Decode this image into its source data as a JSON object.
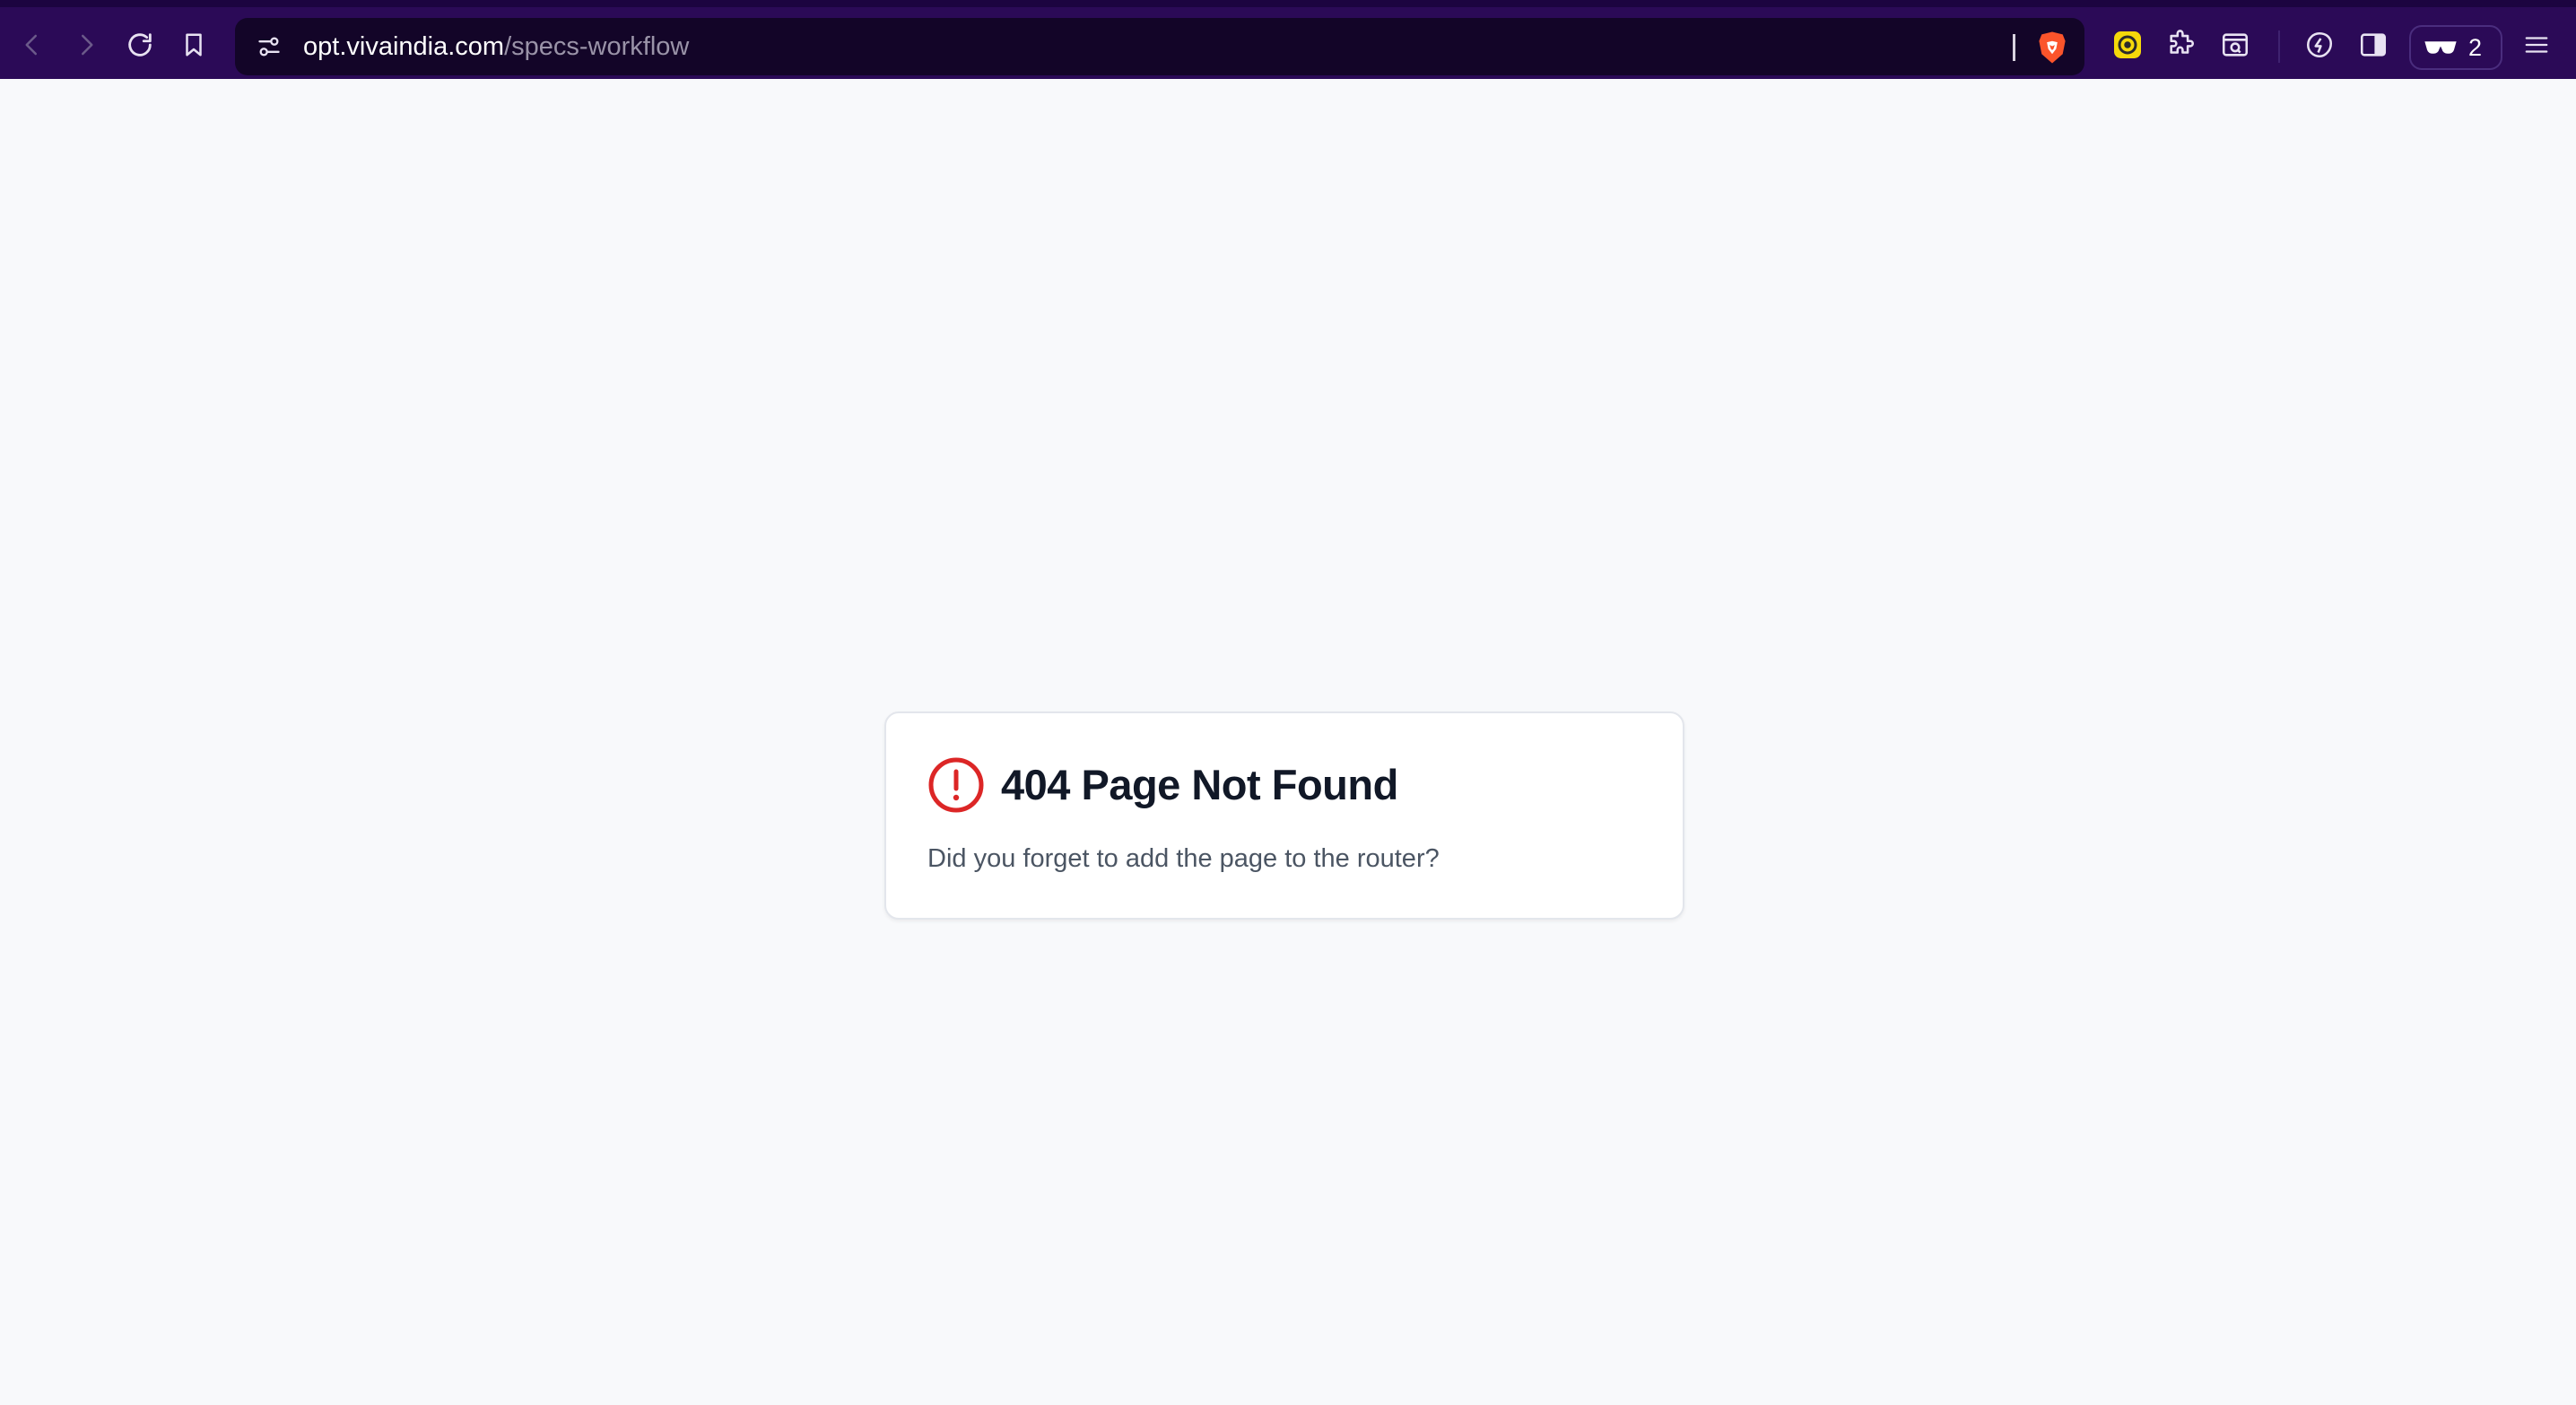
{
  "browser": {
    "url_host": "opt.vivaindia.com",
    "url_path": "/specs-workflow",
    "wallet_count": "2",
    "icons": {
      "back": "back-arrow-icon",
      "forward": "forward-arrow-icon",
      "reload": "reload-icon",
      "bookmark": "bookmark-icon",
      "site_settings": "tune-icon",
      "shields": "brave-shield-icon",
      "extension_1": "yellow-extension-icon",
      "extensions": "puzzle-icon",
      "tab_search": "tab-search-icon",
      "leo": "leo-ai-icon",
      "sidebar": "sidebar-icon",
      "wallet": "glasses-icon",
      "menu": "hamburger-menu-icon"
    }
  },
  "page": {
    "title": "404 Page Not Found",
    "message": "Did you forget to add the page to the router?",
    "icon": "alert-circle-icon",
    "icon_color": "#dc2626"
  },
  "colors": {
    "toolbar_bg": "#2b0a57",
    "omnibox_bg": "#130528",
    "page_bg": "#f8f9fb",
    "brave_orange": "#fb542b"
  }
}
